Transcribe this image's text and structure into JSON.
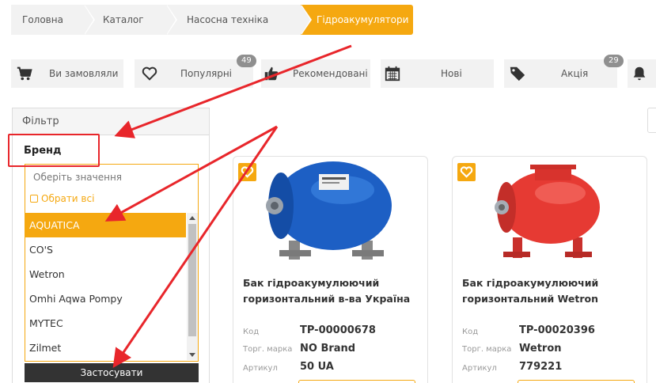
{
  "breadcrumb": [
    "Головна",
    "Каталог",
    "Насосна техніка",
    "Гідроакумулятори"
  ],
  "tabs": {
    "ordered": {
      "label": "Ви замовляли",
      "icon": "cart-icon"
    },
    "popular": {
      "label": "Популярні",
      "icon": "heart-icon",
      "badge": "49"
    },
    "recommended": {
      "label": "Рекомендовані",
      "icon": "thumbs-up-icon"
    },
    "new": {
      "label": "Нові",
      "icon": "calendar-icon"
    },
    "sale": {
      "label": "Акція",
      "icon": "tag-icon",
      "badge": "29"
    },
    "notify": {
      "icon": "bell-icon"
    }
  },
  "filter": {
    "title": "Фільтр",
    "brand_title": "Бренд",
    "search_placeholder": "Оберіть значення",
    "select_all": "Обрати всі",
    "options": [
      "AQUATICA",
      "CO'S",
      "Wetron",
      "Omhi Aqwa Pompy",
      "MYTEC",
      "Zilmet"
    ],
    "selected": "AQUATICA",
    "apply_label": "Застосувати"
  },
  "products": [
    {
      "name": "Бак гідроакумулюючий горизонтальний в-ва Україна",
      "code_label": "Код",
      "code": "TP-00000678",
      "brand_label": "Торг. марка",
      "brand": "NO Brand",
      "article_label": "Артикул",
      "article": "50 UA",
      "image": "blue-pressure-tank"
    },
    {
      "name": "Бак гідроакумулюючий горизонтальний Wetron",
      "code_label": "Код",
      "code": "TP-00020396",
      "brand_label": "Торг. марка",
      "brand": "Wetron",
      "article_label": "Артикул",
      "article": "779221",
      "image": "red-pressure-tank"
    }
  ],
  "colors": {
    "accent": "#f5a810",
    "annotation": "#e8262b",
    "dark": "#333333"
  }
}
